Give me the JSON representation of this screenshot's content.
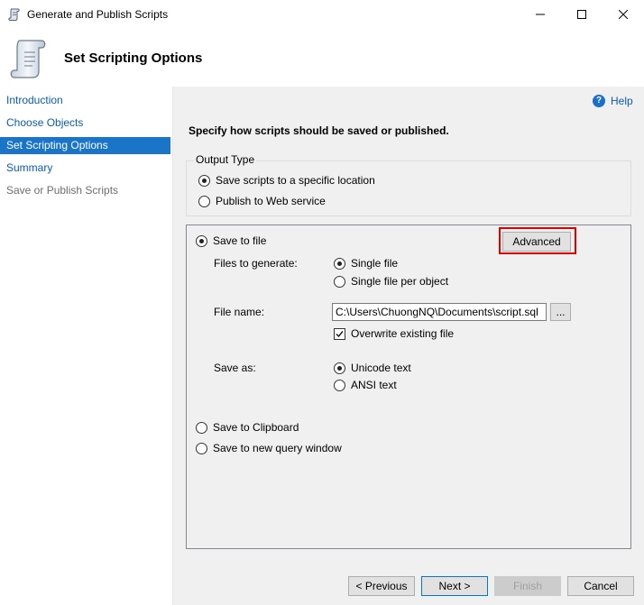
{
  "window": {
    "title": "Generate and Publish Scripts"
  },
  "header": {
    "title": "Set Scripting Options"
  },
  "sidebar": {
    "items": [
      {
        "label": "Introduction",
        "state": "link"
      },
      {
        "label": "Choose Objects",
        "state": "link"
      },
      {
        "label": "Set Scripting Options",
        "state": "active"
      },
      {
        "label": "Summary",
        "state": "link"
      },
      {
        "label": "Save or Publish Scripts",
        "state": "disabled"
      }
    ]
  },
  "help": {
    "label": "Help"
  },
  "instruction": "Specify how scripts should be saved or published.",
  "output_type": {
    "legend": "Output Type",
    "options": [
      {
        "label": "Save scripts to a specific location",
        "checked": true
      },
      {
        "label": "Publish to Web service",
        "checked": false
      }
    ]
  },
  "destination": {
    "save_to_file": {
      "label": "Save to file",
      "checked": true
    },
    "advanced_label": "Advanced",
    "files_to_generate_label": "Files to generate:",
    "files_options": [
      {
        "label": "Single file",
        "checked": true
      },
      {
        "label": "Single file per object",
        "checked": false
      }
    ],
    "file_name_label": "File name:",
    "file_name_value": "C:\\Users\\ChuongNQ\\Documents\\script.sql",
    "browse_label": "...",
    "overwrite": {
      "label": "Overwrite existing file",
      "checked": true
    },
    "save_as_label": "Save as:",
    "save_as_options": [
      {
        "label": "Unicode text",
        "checked": true
      },
      {
        "label": "ANSI text",
        "checked": false
      }
    ],
    "clipboard": {
      "label": "Save to Clipboard",
      "checked": false
    },
    "query_window": {
      "label": "Save to new query window",
      "checked": false
    }
  },
  "footer": {
    "previous_label": "< Previous",
    "next_label": "Next >",
    "finish_label": "Finish",
    "cancel_label": "Cancel"
  },
  "colors": {
    "accent": "#1a74c8",
    "link": "#0b5bb5",
    "highlight": "#e00000",
    "panel_bg": "#f0f0f0"
  }
}
